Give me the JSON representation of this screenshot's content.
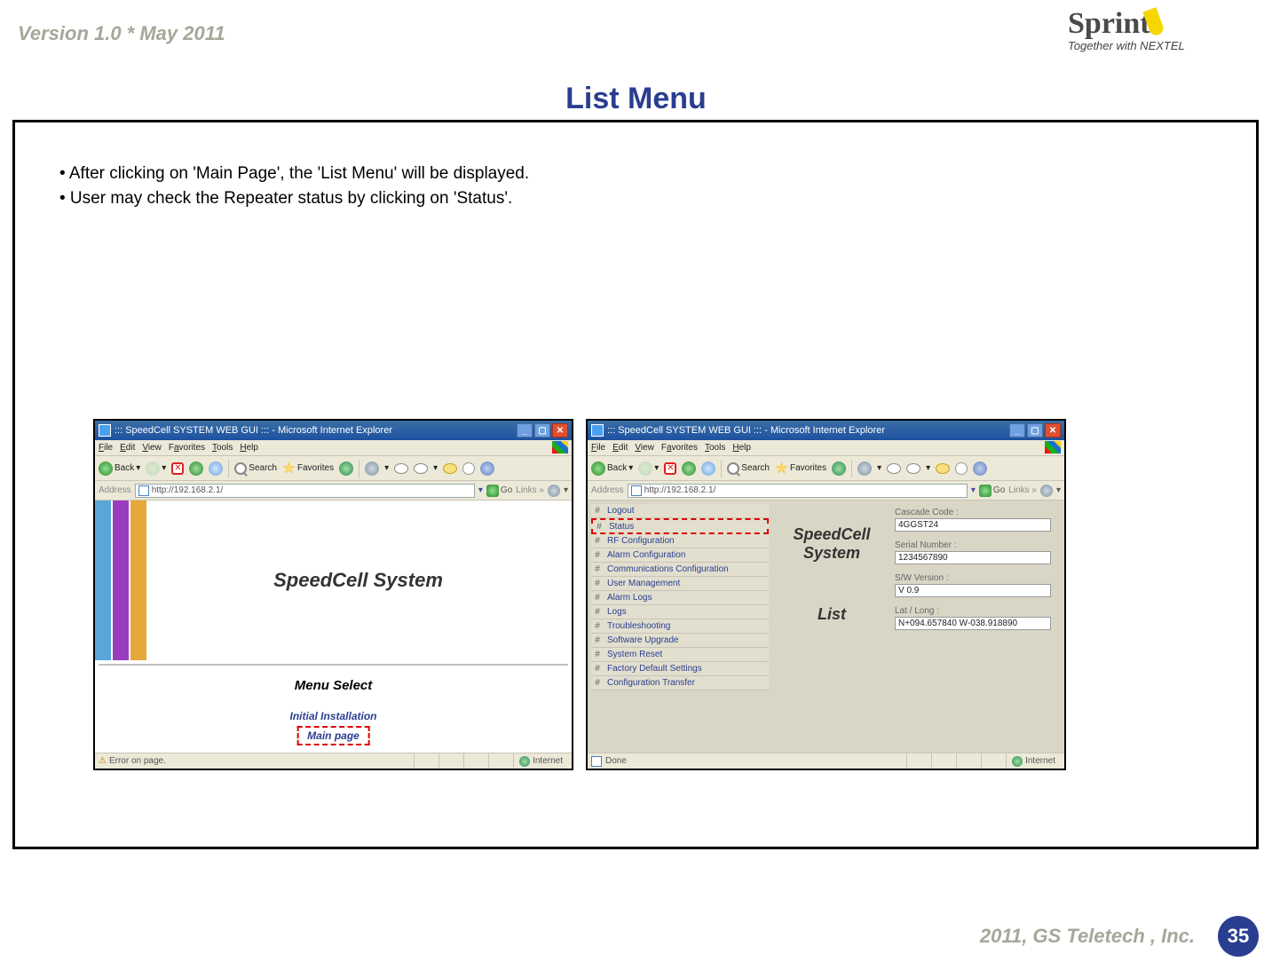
{
  "header": {
    "version_line": "Version 1.0 * May 2011",
    "logo_brand": "Sprint",
    "logo_tagline": "Together with NEXTEL"
  },
  "page_title": "List Menu",
  "bullets": [
    "After clicking on 'Main Page', the 'List Menu' will be displayed.",
    "User may check the Repeater status by clicking on 'Status'."
  ],
  "ie_common": {
    "title": "::: SpeedCell SYSTEM WEB GUI ::: - Microsoft Internet Explorer",
    "menus": {
      "file": "File",
      "edit": "Edit",
      "view": "View",
      "favorites": "Favorites",
      "tools": "Tools",
      "help": "Help"
    },
    "toolbar": {
      "back": "Back",
      "search": "Search",
      "favorites": "Favorites"
    },
    "address_label": "Address",
    "url": "http://192.168.2.1/",
    "go": "Go",
    "links": "Links",
    "internet": "Internet"
  },
  "shot1": {
    "status": "Error on page.",
    "heading": "SpeedCell System",
    "menu_select": "Menu Select",
    "initial_install": "Initial Installation",
    "main_page": "Main page"
  },
  "shot2": {
    "status": "Done",
    "heading1": "SpeedCell",
    "heading2": "System",
    "list_label": "List",
    "menu_items": [
      "Logout",
      "Status",
      "RF Configuration",
      "Alarm Configuration",
      "Communications Configuration",
      "User Management",
      "Alarm Logs",
      "Logs",
      "Troubleshooting",
      "Software Upgrade",
      "System Reset",
      "Factory Default Settings",
      "Configuration Transfer"
    ],
    "highlight_index": 1,
    "fields": {
      "cascade_label": "Cascade Code :",
      "cascade_value": "4GGST24",
      "serial_label": "Serial Number :",
      "serial_value": "1234567890",
      "sw_label": "S/W Version :",
      "sw_value": "V 0.9",
      "latlong_label": "Lat / Long :",
      "latlong_value": "N+094.657840 W-038.918890"
    }
  },
  "footer": {
    "copyright": "2011, GS Teletech , Inc.",
    "page": "35"
  }
}
